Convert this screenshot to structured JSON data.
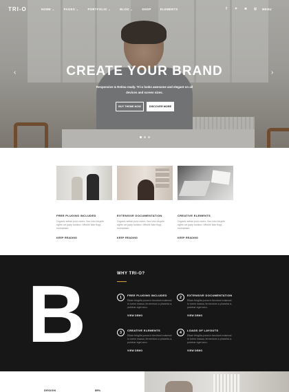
{
  "nav": {
    "logo": "TRI-O",
    "menu": [
      "HOME",
      "PAGES",
      "PORTFOLIO",
      "BLOG",
      "SHOP",
      "ELEMENTS"
    ],
    "social_icons": [
      "facebook-icon",
      "twitter-icon",
      "instagram-icon",
      "dribbble-icon"
    ],
    "menu_label": "MENU"
  },
  "hero": {
    "title": "CREATE YOUR BRAND",
    "subtitle": "Responsive & Retina ready. Tri-o looks awesome and elegant on all devices and screen sizes.",
    "btn_primary": "BUY THEME NOW",
    "btn_secondary": "DISCOVER MORE",
    "slides": 3,
    "active_slide": 1
  },
  "features": [
    {
      "title": "FREE PLUGINS INCLUDED",
      "text": "Organic seitan pour-overs, four loko bicycle rights art party busked. Mlkshk kale tbqq stumptown.",
      "link": "KEEP READING"
    },
    {
      "title": "EXTENSIVE DOCUMENTATION",
      "text": "Organic seitan pour-overs, four loko bicycle rights art party busked. Mlkshk kale tbqq stumptown.",
      "link": "KEEP READING"
    },
    {
      "title": "CREATIVE ELEMENTS",
      "text": "Organic seitan pour-overs, four loko bicycle rights art party busked. Mlkshk kale tbqq stumptown.",
      "link": "KEEP READING"
    }
  ],
  "why": {
    "big_letter": "B",
    "title": "WHY TRI-O?",
    "accent": "#d9a441",
    "reasons": [
      {
        "num": "1",
        "title": "FREE PLUGINS INCLUDED",
        "text": "Etiam fringilla purus in tincidunt euismod. In lorem massa, fermentum a pharetra a, pulvinar eget arcu.",
        "link": "VIEW DEMO"
      },
      {
        "num": "2",
        "title": "EXTENSIVE DOCUMENTATION",
        "text": "Etiam fringilla purus in tincidunt euismod. In lorem massa, fermentum a pharetra a, pulvinar eget arcu.",
        "link": "VIEW DEMO"
      },
      {
        "num": "3",
        "title": "CREATIVE ELEMENTS",
        "text": "Etiam fringilla purus in tincidunt euismod. In lorem massa, fermentum a pharetra a, pulvinar eget arcu.",
        "link": "VIEW DEMO"
      },
      {
        "num": "4",
        "title": "LOADS OF LAYOUTS",
        "text": "Etiam fringilla purus in tincidunt euismod. In lorem massa, fermentum a pharetra a, pulvinar eget arcu.",
        "link": "VIEW DEMO"
      }
    ]
  },
  "skills": {
    "label": "DESIGN",
    "value": "85%"
  }
}
